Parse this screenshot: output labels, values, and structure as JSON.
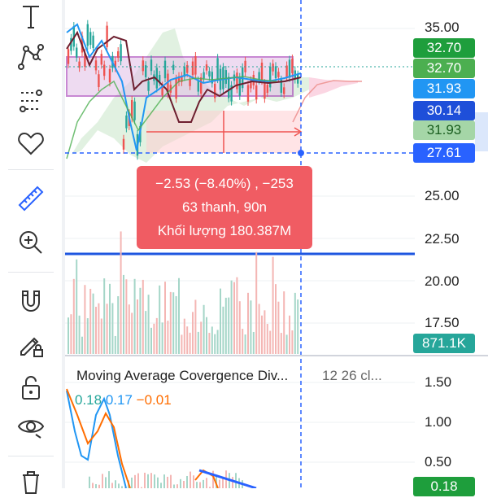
{
  "toolbar": {
    "tools": [
      {
        "name": "text-tool"
      },
      {
        "name": "pattern-tool"
      },
      {
        "name": "fib-tool"
      },
      {
        "name": "favorite-tool"
      },
      {
        "name": "measure-tool"
      },
      {
        "name": "zoom-in-tool"
      },
      {
        "name": "magnet-tool"
      },
      {
        "name": "lock-drawing-tool"
      },
      {
        "name": "lock-tool"
      },
      {
        "name": "visibility-tool"
      },
      {
        "name": "delete-tool"
      }
    ]
  },
  "price_axis": {
    "labels": [
      "35.00",
      "25.00",
      "22.50",
      "20.00",
      "17.50"
    ],
    "badges": [
      {
        "text": "32.70",
        "color": "#1e9e3c"
      },
      {
        "text": "32.70",
        "color": "#4caf50"
      },
      {
        "text": "31.93",
        "color": "#2196f3"
      },
      {
        "text": "30.14",
        "color": "#1e4fd9"
      },
      {
        "text": "31.93",
        "color": "#a5d6a7"
      },
      {
        "text": "27.61",
        "color": "#2962ff"
      }
    ],
    "volume_badge": {
      "text": "871.1K",
      "color": "#26a69a"
    }
  },
  "measure_tooltip": {
    "line1": "−2.53 (−8.40%) , −253",
    "line2": "63 thanh, 90n",
    "line3": "Khối lượng 180.387M"
  },
  "macd": {
    "title": "Moving Average Covergence Div...",
    "params": "12 26 cl...",
    "values": {
      "v1": "0.18",
      "v2": "0.17",
      "v3": "−0.01"
    },
    "colors": {
      "v1": "#26a69a",
      "v2": "#2196f3",
      "v3": "#ff6d00"
    },
    "axis_labels": [
      "1.50",
      "1.00",
      "0.50"
    ],
    "badge": {
      "text": "0.18",
      "color": "#1e9e3c"
    }
  },
  "colors": {
    "up": "#26a69a",
    "down": "#ef5350",
    "accent": "#2962ff",
    "tooltip": "#f05c63"
  }
}
